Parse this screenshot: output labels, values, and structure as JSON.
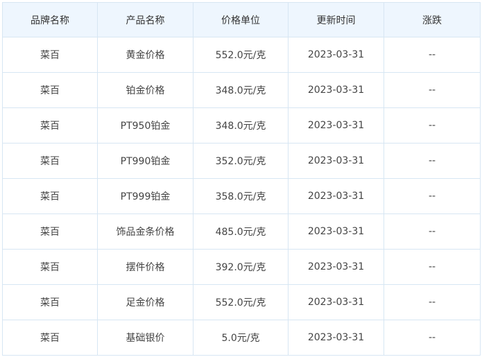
{
  "table": {
    "headers": [
      "品牌名称",
      "产品名称",
      "价格单位",
      "更新时间",
      "涨跌"
    ],
    "rows": [
      [
        "菜百",
        "黄金价格",
        "552.0元/克",
        "2023-03-31",
        "--"
      ],
      [
        "菜百",
        "铂金价格",
        "348.0元/克",
        "2023-03-31",
        "--"
      ],
      [
        "菜百",
        "PT950铂金",
        "348.0元/克",
        "2023-03-31",
        "--"
      ],
      [
        "菜百",
        "PT990铂金",
        "352.0元/克",
        "2023-03-31",
        "--"
      ],
      [
        "菜百",
        "PT999铂金",
        "358.0元/克",
        "2023-03-31",
        "--"
      ],
      [
        "菜百",
        "饰品金条价格",
        "485.0元/克",
        "2023-03-31",
        "--"
      ],
      [
        "菜百",
        "摆件价格",
        "392.0元/克",
        "2023-03-31",
        "--"
      ],
      [
        "菜百",
        "足金价格",
        "552.0元/克",
        "2023-03-31",
        "--"
      ],
      [
        "菜百",
        "基础银价",
        "5.0元/克",
        "2023-03-31",
        "--"
      ]
    ]
  },
  "colors": {
    "header_bg": "#eef6fe",
    "border": "#d7e6f3"
  }
}
